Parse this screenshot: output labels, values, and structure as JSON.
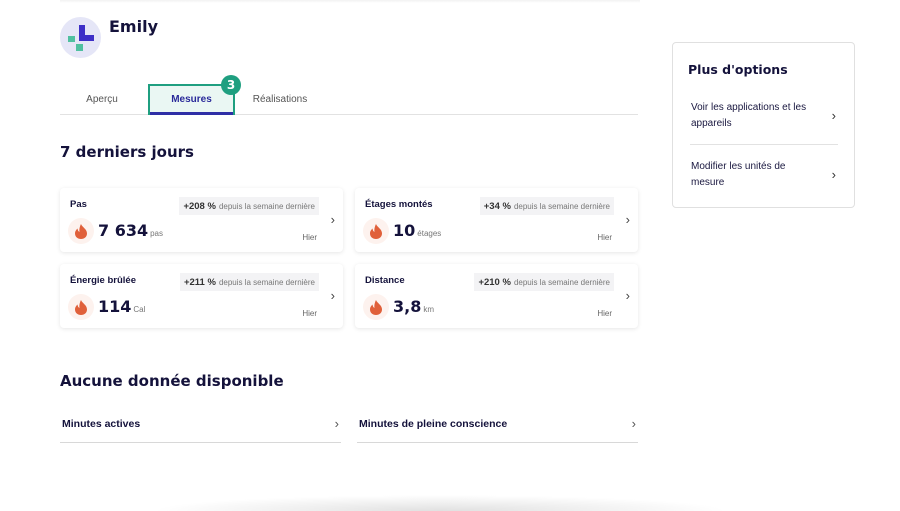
{
  "profile": {
    "name": "Emily",
    "avatar_icon": "health-plus-logo",
    "avatar_colors": {
      "bg": "#e5e6f7",
      "primary": "#3d2fc7",
      "secondary": "#4fc0a0"
    }
  },
  "tabs": [
    {
      "label": "Aperçu",
      "active": false
    },
    {
      "label": "Mesures",
      "active": true,
      "badge": "3"
    },
    {
      "label": "Réalisations",
      "active": false
    }
  ],
  "colors": {
    "accent": "#1f9f80",
    "tab_underline": "#2f2fa6",
    "flame": "#e0603a",
    "text_dark": "#14123b"
  },
  "last7days": {
    "title": "7 derniers jours",
    "cards": [
      {
        "title": "Pas",
        "change_value": "+208 %",
        "change_text": "depuis la semaine dernière",
        "value": "7 634",
        "unit": "pas",
        "date": "Hier",
        "icon": "flame-icon"
      },
      {
        "title": "Étages montés",
        "change_value": "+34 %",
        "change_text": "depuis la semaine dernière",
        "value": "10",
        "unit": "étages",
        "date": "Hier",
        "icon": "flame-icon"
      },
      {
        "title": "Énergie brûlée",
        "change_value": "+211 %",
        "change_text": "depuis la semaine dernière",
        "value": "114",
        "unit": "Cal",
        "date": "Hier",
        "icon": "flame-icon"
      },
      {
        "title": "Distance",
        "change_value": "+210 %",
        "change_text": "depuis la semaine dernière",
        "value": "3,8",
        "unit": "km",
        "date": "Hier",
        "icon": "flame-icon"
      }
    ]
  },
  "no_data": {
    "title": "Aucune donnée disponible",
    "items": [
      {
        "label": "Minutes actives"
      },
      {
        "label": "Minutes de pleine conscience"
      }
    ]
  },
  "options": {
    "title": "Plus d'options",
    "items": [
      {
        "label": "Voir les applications et les appareils"
      },
      {
        "label": "Modifier les unités de mesure"
      }
    ]
  },
  "chevron": "›"
}
